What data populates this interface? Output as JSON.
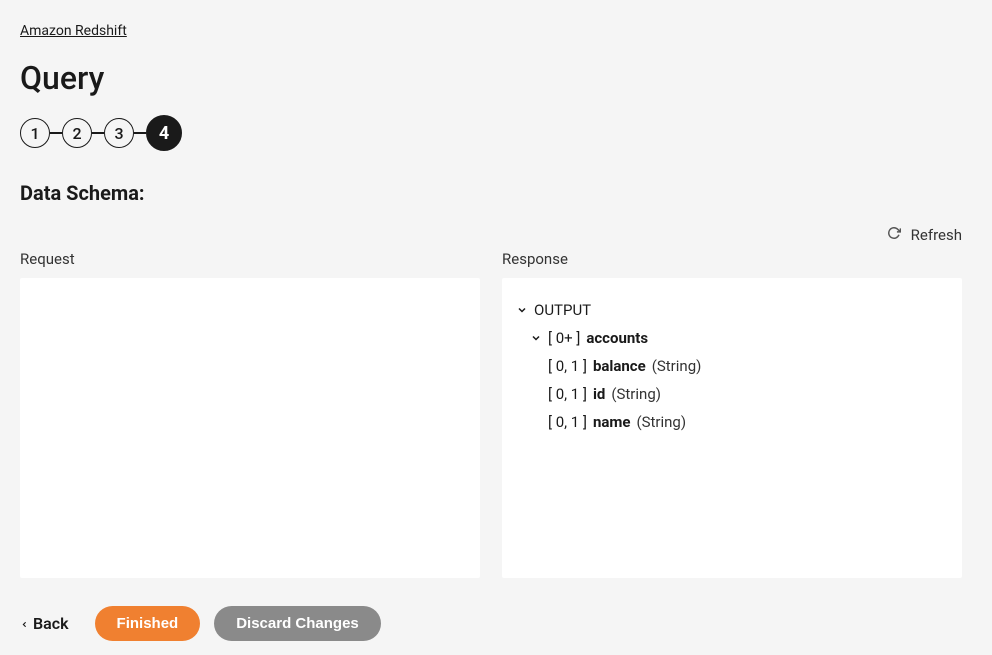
{
  "breadcrumb": "Amazon Redshift",
  "page_title": "Query",
  "stepper": {
    "steps": [
      "1",
      "2",
      "3",
      "4"
    ],
    "active_index": 3
  },
  "section_label": "Data Schema:",
  "refresh_label": "Refresh",
  "panels": {
    "request": {
      "label": "Request",
      "content": ""
    },
    "response": {
      "label": "Response",
      "tree": {
        "root_label": "OUTPUT",
        "node_cardinality": "[ 0+ ]",
        "node_name": "accounts",
        "fields": [
          {
            "cardinality": "[ 0, 1 ]",
            "name": "balance",
            "type": "(String)"
          },
          {
            "cardinality": "[ 0, 1 ]",
            "name": "id",
            "type": "(String)"
          },
          {
            "cardinality": "[ 0, 1 ]",
            "name": "name",
            "type": "(String)"
          }
        ]
      }
    }
  },
  "footer": {
    "back": "Back",
    "finished": "Finished",
    "discard": "Discard Changes"
  }
}
